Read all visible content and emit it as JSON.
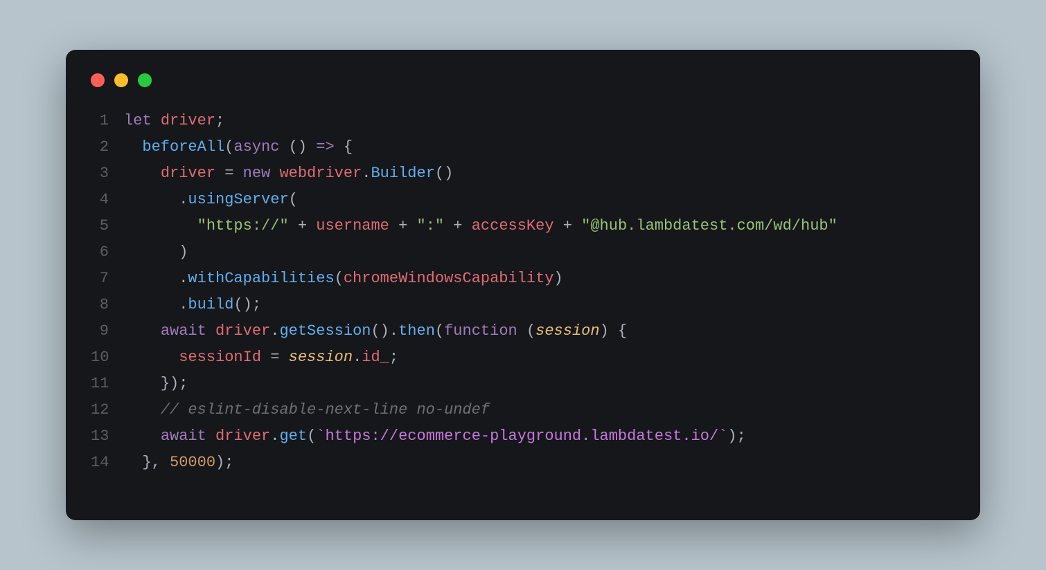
{
  "colors": {
    "bg": "#b7c4cc",
    "editor_bg": "#16171a",
    "red": "#ff5f56",
    "yellow": "#ffbd2e",
    "green": "#27c93f"
  },
  "lines": [
    {
      "n": "1",
      "tokens": [
        [
          "kw",
          "let "
        ],
        [
          "id",
          "driver"
        ],
        [
          "punc",
          ";"
        ]
      ]
    },
    {
      "n": "2",
      "tokens": [
        [
          "punc",
          "  "
        ],
        [
          "fn",
          "beforeAll"
        ],
        [
          "punc",
          "("
        ],
        [
          "kw",
          "async"
        ],
        [
          "punc",
          " () "
        ],
        [
          "kw",
          "=>"
        ],
        [
          "punc",
          " {"
        ]
      ]
    },
    {
      "n": "3",
      "tokens": [
        [
          "punc",
          "    "
        ],
        [
          "id",
          "driver"
        ],
        [
          "punc",
          " = "
        ],
        [
          "kw",
          "new"
        ],
        [
          "punc",
          " "
        ],
        [
          "id",
          "webdriver"
        ],
        [
          "punc",
          "."
        ],
        [
          "fn",
          "Builder"
        ],
        [
          "punc",
          "()"
        ]
      ]
    },
    {
      "n": "4",
      "tokens": [
        [
          "punc",
          "      ."
        ],
        [
          "fn",
          "usingServer"
        ],
        [
          "punc",
          "("
        ]
      ]
    },
    {
      "n": "5",
      "tokens": [
        [
          "punc",
          "        "
        ],
        [
          "str",
          "\"https://\""
        ],
        [
          "punc",
          " + "
        ],
        [
          "id",
          "username"
        ],
        [
          "punc",
          " + "
        ],
        [
          "str",
          "\":\""
        ],
        [
          "punc",
          " + "
        ],
        [
          "id",
          "accessKey"
        ],
        [
          "punc",
          " + "
        ],
        [
          "str",
          "\"@hub.lambdatest.com/wd/hub\""
        ]
      ]
    },
    {
      "n": "6",
      "tokens": [
        [
          "punc",
          "      )"
        ]
      ]
    },
    {
      "n": "7",
      "tokens": [
        [
          "punc",
          "      ."
        ],
        [
          "fn",
          "withCapabilities"
        ],
        [
          "punc",
          "("
        ],
        [
          "id",
          "chromeWindowsCapability"
        ],
        [
          "punc",
          ")"
        ]
      ]
    },
    {
      "n": "8",
      "tokens": [
        [
          "punc",
          "      ."
        ],
        [
          "fn",
          "build"
        ],
        [
          "punc",
          "();"
        ]
      ]
    },
    {
      "n": "9",
      "tokens": [
        [
          "punc",
          "    "
        ],
        [
          "kw",
          "await"
        ],
        [
          "punc",
          " "
        ],
        [
          "id",
          "driver"
        ],
        [
          "punc",
          "."
        ],
        [
          "fn",
          "getSession"
        ],
        [
          "punc",
          "()."
        ],
        [
          "fn",
          "then"
        ],
        [
          "punc",
          "("
        ],
        [
          "kw",
          "function"
        ],
        [
          "punc",
          " ("
        ],
        [
          "param",
          "session"
        ],
        [
          "punc",
          ") {"
        ]
      ]
    },
    {
      "n": "10",
      "tokens": [
        [
          "punc",
          "      "
        ],
        [
          "id",
          "sessionId"
        ],
        [
          "punc",
          " = "
        ],
        [
          "param",
          "session"
        ],
        [
          "punc",
          "."
        ],
        [
          "id",
          "id_"
        ],
        [
          "punc",
          ";"
        ]
      ]
    },
    {
      "n": "11",
      "tokens": [
        [
          "punc",
          "    });"
        ]
      ]
    },
    {
      "n": "12",
      "tokens": [
        [
          "punc",
          "    "
        ],
        [
          "cmt",
          "// eslint-disable-next-line no-undef"
        ]
      ]
    },
    {
      "n": "13",
      "tokens": [
        [
          "punc",
          "    "
        ],
        [
          "kw",
          "await"
        ],
        [
          "punc",
          " "
        ],
        [
          "id",
          "driver"
        ],
        [
          "punc",
          "."
        ],
        [
          "fn",
          "get"
        ],
        [
          "punc",
          "("
        ],
        [
          "tmpl",
          "`https://ecommerce-playground.lambdatest.io/`"
        ],
        [
          "punc",
          ");"
        ]
      ]
    },
    {
      "n": "14",
      "tokens": [
        [
          "punc",
          "  }, "
        ],
        [
          "num",
          "50000"
        ],
        [
          "punc",
          ");"
        ]
      ]
    }
  ]
}
